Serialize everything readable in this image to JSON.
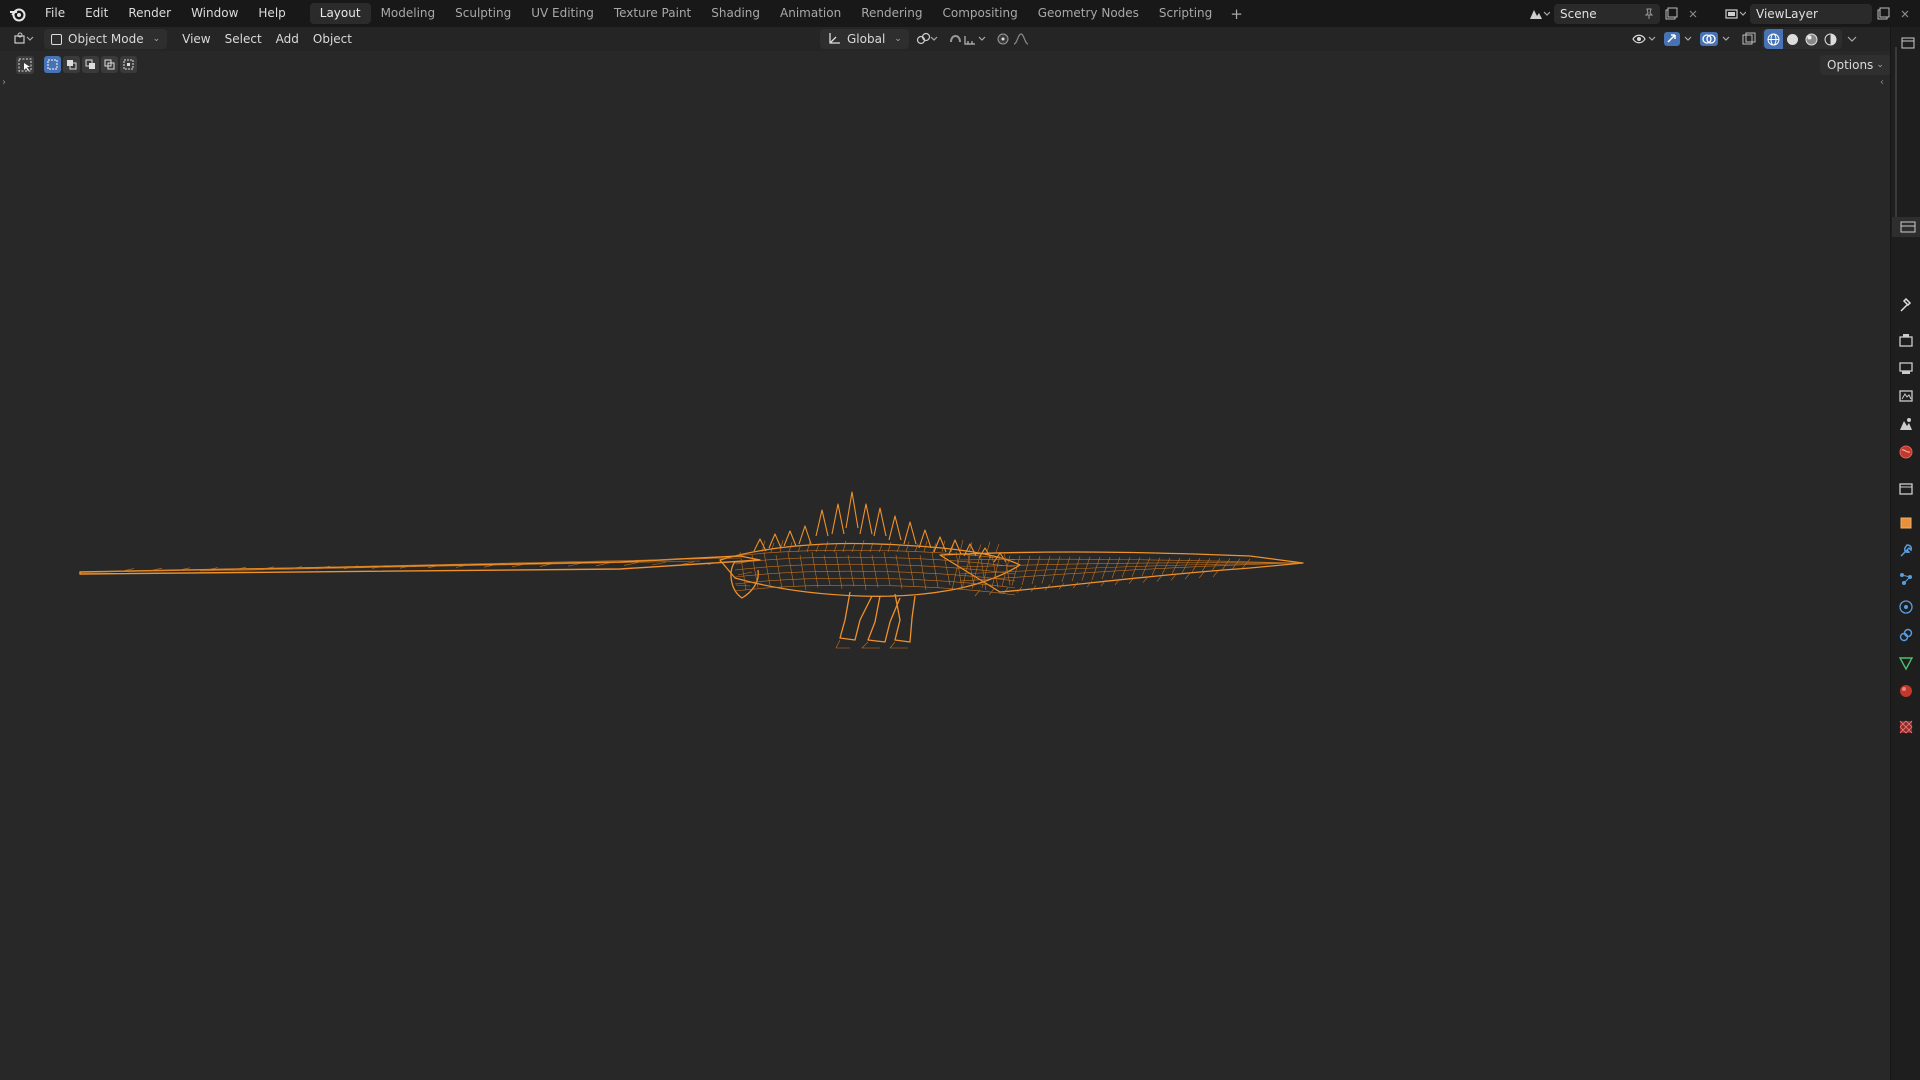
{
  "app": {
    "menu": [
      "File",
      "Edit",
      "Render",
      "Window",
      "Help"
    ],
    "workspaces": [
      "Layout",
      "Modeling",
      "Sculpting",
      "UV Editing",
      "Texture Paint",
      "Shading",
      "Animation",
      "Rendering",
      "Compositing",
      "Geometry Nodes",
      "Scripting"
    ],
    "active_workspace": "Layout",
    "scene_name": "Scene",
    "view_layer_name": "ViewLayer"
  },
  "viewport_header": {
    "mode": "Object Mode",
    "menus": [
      "View",
      "Select",
      "Add",
      "Object"
    ],
    "transform_orientation": "Global",
    "options_label": "Options"
  },
  "colors": {
    "wire": "#f0912a",
    "background": "#282828",
    "active_tab": "#2b2b2b",
    "accent": "#4772b3"
  },
  "icons": [
    "blender-logo-icon",
    "editor-type-icon",
    "object-mode-icon",
    "transform-orientation-icon",
    "pivot-icon",
    "snap-icon",
    "proportional-edit-icon",
    "visibility-icon",
    "gizmo-icon",
    "overlay-icon",
    "xray-icon",
    "shading-wireframe-icon",
    "shading-solid-icon",
    "shading-material-icon",
    "shading-rendered-icon",
    "tool-icon",
    "render-properties-icon",
    "output-properties-icon",
    "view-layer-icon",
    "scene-icon",
    "world-icon",
    "collection-icon",
    "object-properties-icon",
    "modifier-icon",
    "particles-icon",
    "physics-icon",
    "constraints-icon",
    "data-icon",
    "material-icon",
    "texture-icon"
  ]
}
